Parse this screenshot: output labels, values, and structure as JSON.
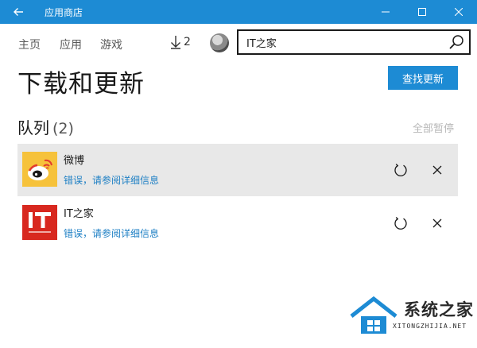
{
  "window": {
    "title": "应用商店",
    "accent": "#1d8bd4"
  },
  "nav": {
    "home": "主页",
    "apps": "应用",
    "games": "游戏",
    "downloads_count": "2",
    "search_value": "IT之家"
  },
  "page": {
    "title": "下载和更新",
    "check_updates": "查找更新"
  },
  "queue": {
    "label": "队列",
    "count": "(2)",
    "pause_all": "全部暂停",
    "items": [
      {
        "name": "微博",
        "status": "错误，请参阅详细信息",
        "icon": "weibo-icon",
        "selected": true
      },
      {
        "name": "IT之家",
        "status": "错误，请参阅详细信息",
        "icon": "ithome-icon",
        "selected": false
      }
    ]
  },
  "watermark": {
    "text": "系统之家",
    "sub": "XITONGZHIJIA.NET"
  }
}
